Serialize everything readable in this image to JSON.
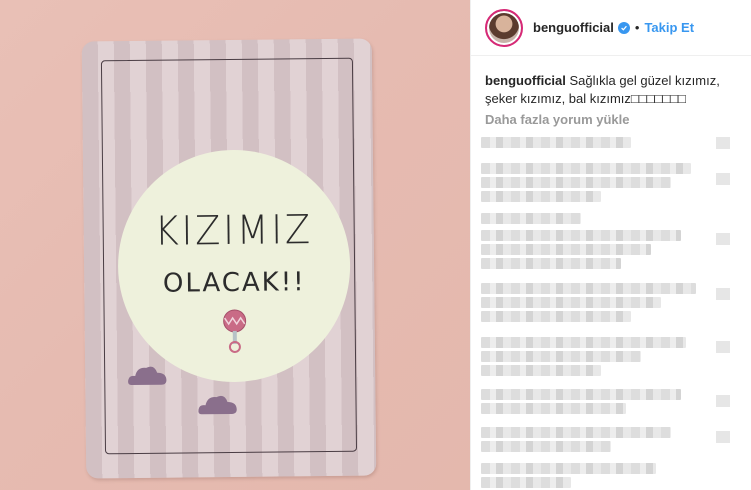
{
  "post": {
    "card": {
      "title": "KIZIMIZ",
      "subtitle": "OLACAK!!"
    }
  },
  "header": {
    "username": "benguofficial",
    "separator": "•",
    "follow_label": "Takip Et"
  },
  "caption": {
    "username": "benguofficial",
    "text": "Sağlıkla gel güzel kızımız, şeker kızımız, bal kızımız□□□□□□□"
  },
  "load_more": "Daha fazla yorum yükle",
  "colors": {
    "accent": "#3897f0",
    "muted": "#999999",
    "background_photo": "#e8bdb3"
  },
  "comments_state": "blurred"
}
